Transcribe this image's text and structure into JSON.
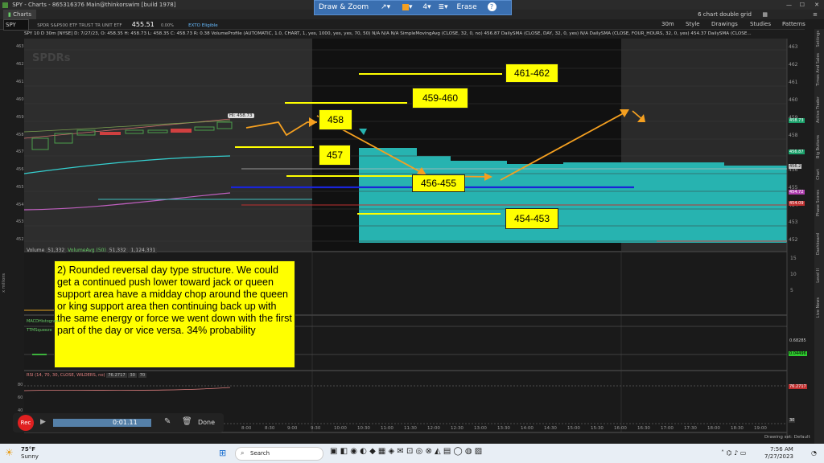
{
  "window": {
    "title": "SPY - Charts - 865316376 Main@thinkorswim [build 1978]",
    "tab": "Charts",
    "layout": "6 chart double grid"
  },
  "draw_toolbar": {
    "label": "Draw & Zoom",
    "line_width": "4",
    "erase": "Erase",
    "help": "?"
  },
  "toolbar": {
    "symbol": "SPY",
    "name": "SPDR S&P500 ETF TRUST TR UNIT ETF",
    "price": "455.51",
    "change": "0.00%",
    "badge": "EXTO Eligible",
    "period": "30m",
    "menus": [
      "Style",
      "Drawings",
      "Studies",
      "Patterns"
    ]
  },
  "info_bar": {
    "text": "SPY 10 D 30m [NYSE]  D: 7/27/23, O: 458.35  H: 458.73  L: 458.35  C: 458.73  R: 0.38   VolumeProfile (AUTOMATIC, 1.0, CHART, 1, yes, 1000, yes, yes, 70, 50)  N/A  N/A  N/A  SimpleMovingAvg (CLOSE, 32, 0, no) 456.87  DailySMA (CLOSE, DAY, 32, 0, yes)  N/A  DailySMA (CLOSE, FOUR_HOURS, 32, 0, yes) 454.37  DailySMA (CLOSE..."
  },
  "price_axis": [
    "463",
    "462",
    "461",
    "460",
    "459",
    "458",
    "457",
    "456",
    "455",
    "454",
    "453",
    "452"
  ],
  "price_flags": [
    {
      "text": "458.73",
      "color": "#1aa06a"
    },
    {
      "text": "456.87",
      "color": "#1aa06a"
    },
    {
      "text": "456.2",
      "color": "#c9c9c9"
    },
    {
      "text": "454.72",
      "color": "#b040b0"
    },
    {
      "text": "454.09",
      "color": "#c03030"
    }
  ],
  "hi_label": "Hi: 458.73",
  "levels": [
    "461-462",
    "459-460",
    "458",
    "457",
    "456-455",
    "454-453"
  ],
  "volume_panel": {
    "label": "Volume",
    "values": [
      "51,332",
      "VolumeAvg (50)",
      "51,332",
      "1,124,331"
    ],
    "axis": [
      "15",
      "10",
      "5"
    ],
    "axis_title": "x millions"
  },
  "macd_panel": {
    "label": "MACDHistogram",
    "sub": "TTMSqueeze",
    "v1": "0.68285",
    "v2": "0.04496"
  },
  "rsi_panel": {
    "label": "RSI (14, 70, 30, CLOSE, WILDERS, no)",
    "value": "76.2717",
    "b1": "30",
    "b2": "70",
    "axis": [
      "80",
      "60",
      "40",
      "20"
    ],
    "flag": "76.2717",
    "low": "30"
  },
  "time_axis": [
    "8:00",
    "8:30",
    "9:00",
    "9:30",
    "10:00",
    "10:30",
    "11:00",
    "11:30",
    "12:00",
    "12:30",
    "13:00",
    "13:30",
    "14:00",
    "14:30",
    "15:00",
    "15:30",
    "16:00",
    "16:30",
    "17:00",
    "17:30",
    "18:00",
    "18:30",
    "19:00"
  ],
  "note": "2) Rounded reversal day type structure. We could get a continued push lower toward jack or queen support area have a midday chop around the queen or king support area then continuing back up with the same energy or force we went down with the first part of the day or vice versa.  34% probability",
  "recorder": {
    "rec": "Rec",
    "time": "0:01.11",
    "done": "Done"
  },
  "drawing_set": "Drawing set: Default",
  "right_tabs": [
    "Live News",
    "Level II",
    "Dashboard",
    "Phase Scores",
    "Chart",
    "Big Buttons",
    "Active Trader",
    "Times And Sales",
    "Settings"
  ],
  "weather": {
    "temp": "75°F",
    "cond": "Sunny"
  },
  "taskbar": {
    "search": "Search",
    "time": "7:56 AM",
    "date": "7/27/2023"
  },
  "colors": {
    "yellow": "#ffff00",
    "teal": "#27b3b0",
    "blue": "#1a24d8",
    "orange": "#f5a020"
  }
}
